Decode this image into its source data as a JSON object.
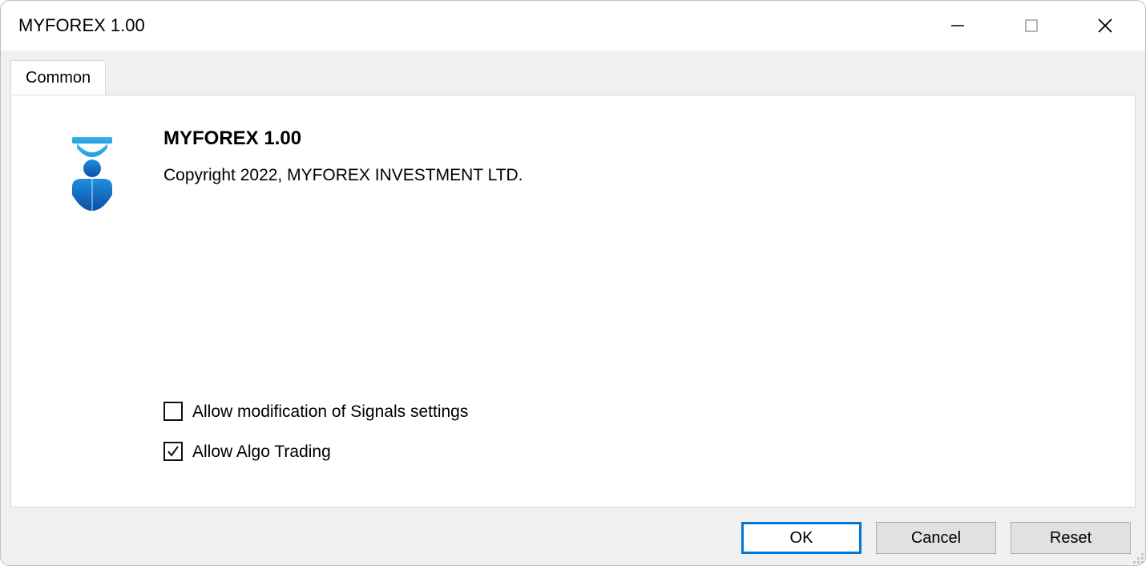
{
  "window": {
    "title": "MYFOREX 1.00"
  },
  "tabs": {
    "common": {
      "label": "Common"
    }
  },
  "info": {
    "title": "MYFOREX 1.00",
    "copyright": "Copyright 2022, MYFOREX INVESTMENT LTD."
  },
  "checkboxes": {
    "allow_signals": {
      "label": "Allow modification of Signals settings",
      "checked": false
    },
    "allow_algo": {
      "label": "Allow Algo Trading",
      "checked": true
    }
  },
  "buttons": {
    "ok": "OK",
    "cancel": "Cancel",
    "reset": "Reset"
  },
  "icons": {
    "minimize": "minimize-icon",
    "maximize": "maximize-icon",
    "close": "close-icon",
    "expert": "expert-advisor-icon"
  }
}
